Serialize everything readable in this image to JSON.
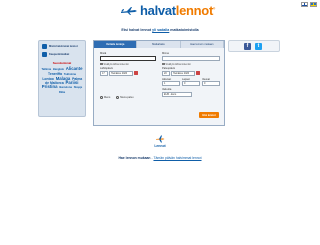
{
  "header": {
    "logo_part1": "halvat",
    "logo_part2": "lennot",
    "logo_reg": "®",
    "tagline_before": "Etsi halvat lennot ",
    "tagline_link": "yli sadalla",
    "tagline_after": " matkatoimistolla"
  },
  "flags": [
    "fi-flag",
    "se-flag"
  ],
  "left_panel": {
    "item1": "Mistä halvimmat lennot",
    "item2": "Kaupunkimatkat",
    "red_label": "Suosituimmat",
    "cloud": [
      {
        "t": "Tallinna",
        "s": "sm"
      },
      {
        "t": "Bangkok",
        "s": "sm"
      },
      {
        "t": "Alicante",
        "s": "lg"
      },
      {
        "t": "Teneriffa",
        "s": "md"
      },
      {
        "t": "Tukholma",
        "s": "sm"
      },
      {
        "t": "Lontoo",
        "s": "md"
      },
      {
        "t": "Malaga",
        "s": "lg"
      },
      {
        "t": "Palma de Mallorca",
        "s": "md"
      },
      {
        "t": "Pariisi",
        "s": "lg"
      },
      {
        "t": "Pristina",
        "s": "lg"
      },
      {
        "t": "Barcelona",
        "s": "sm"
      },
      {
        "t": "Skopje",
        "s": "sm"
      },
      {
        "t": "Riika",
        "s": "sm"
      }
    ]
  },
  "tabs": [
    "Vertaile lentoja",
    "Matkahaku",
    "Hae lennon mukaan"
  ],
  "form": {
    "from_label": "Mistä",
    "to_label": "Minne",
    "nearby_from": "Sisällytä lähilentokentät",
    "nearby_to": "Sisällytä lähilentokentät",
    "depart_label": "Lähtöpäivä",
    "return_label": "Paluupäivä",
    "depart_day": "17",
    "depart_month": "Heinäkuu 2020",
    "return_day": "20",
    "return_month": "Heinäkuu 2020",
    "adults_label": "Aikuiset",
    "children_label": "Lapset",
    "infants_label": "Vauvat",
    "adults_val": "1",
    "children_val": "0",
    "infants_val": "0",
    "class_label": "Matkustusluokka",
    "class_val": "Halpa",
    "radio_oneway": "Meno",
    "radio_return": "Meno-paluu",
    "search_btn": "Etsi lennot",
    "currency_label": "Valuutta",
    "currency_val": "EUR - Euro"
  },
  "social": [
    "facebook-icon",
    "twitter-icon"
  ],
  "footer": {
    "lennot_label": "Lennot",
    "bottom_strong": "Hae lennon mukaan",
    "bottom_sep": " - ",
    "bottom_link": "Tämän päivän halvimmat lennot"
  }
}
